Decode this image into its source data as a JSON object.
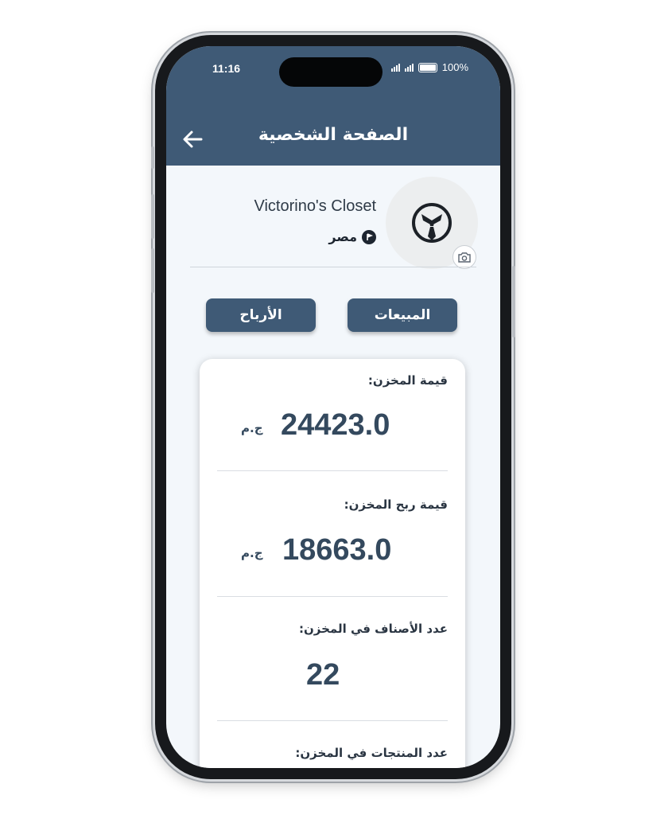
{
  "status_bar": {
    "time": "11:16",
    "battery": "100%"
  },
  "header": {
    "title": "الصفحة الشخصية"
  },
  "profile": {
    "store_name": "Victorino's Closet",
    "country": "مصر"
  },
  "tabs": [
    {
      "label": "المبيعات"
    },
    {
      "label": "الأرباح"
    }
  ],
  "stats": [
    {
      "label": "قيمة المخزن:",
      "value": "24423.0",
      "unit": "ج.م"
    },
    {
      "label": "قيمة ربح المخزن:",
      "value": "18663.0",
      "unit": "ج.م"
    },
    {
      "label": "عدد الأصناف في المخزن:",
      "value": "22"
    },
    {
      "label": "عدد المنتجات في المخزن:"
    }
  ],
  "colors": {
    "header": "#3f5a76",
    "background": "#f3f7fb",
    "text_value": "#34495e"
  },
  "icons": [
    "back-arrow-icon",
    "tie-logo-icon",
    "camera-icon",
    "location-icon",
    "signal-icon",
    "battery-icon"
  ]
}
